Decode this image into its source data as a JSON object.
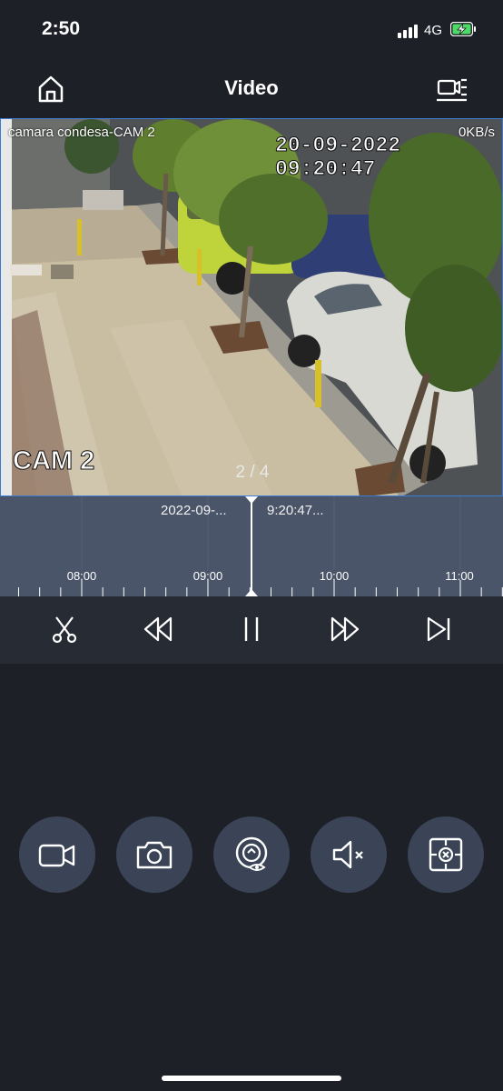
{
  "status_bar": {
    "time": "2:50",
    "network": "4G"
  },
  "header": {
    "title": "Video",
    "home_icon": "home-icon",
    "camera_list_icon": "camera-list-icon"
  },
  "video": {
    "camera_name": "camara condesa-CAM 2",
    "bitrate": "0KB/s",
    "osd_timestamp": "20-09-2022 09:20:47",
    "osd_camera_label": "CAM 2",
    "page_indicator": "2 / 4"
  },
  "timeline": {
    "current_date": "2022-09-...",
    "current_time": "9:20:47...",
    "hour_labels": [
      "08:00",
      "09:00",
      "10:00",
      "11:00"
    ]
  },
  "playback_controls": [
    {
      "name": "clip",
      "icon": "scissors-icon"
    },
    {
      "name": "rewind",
      "icon": "rewind-icon"
    },
    {
      "name": "pause",
      "icon": "pause-icon"
    },
    {
      "name": "fast-forward",
      "icon": "fast-forward-icon"
    },
    {
      "name": "next-frame",
      "icon": "skip-next-icon"
    }
  ],
  "action_buttons": [
    {
      "name": "record",
      "icon": "video-camera-icon"
    },
    {
      "name": "snapshot",
      "icon": "camera-icon"
    },
    {
      "name": "intercom",
      "icon": "intercom-icon"
    },
    {
      "name": "mute",
      "icon": "speaker-muted-icon"
    },
    {
      "name": "ptz",
      "icon": "ptz-icon"
    }
  ],
  "colors": {
    "background": "#1d2027",
    "timeline": "#4b5569",
    "controls": "#272b34",
    "round_button": "#3a4456",
    "selection_border": "#3a7bd5"
  }
}
